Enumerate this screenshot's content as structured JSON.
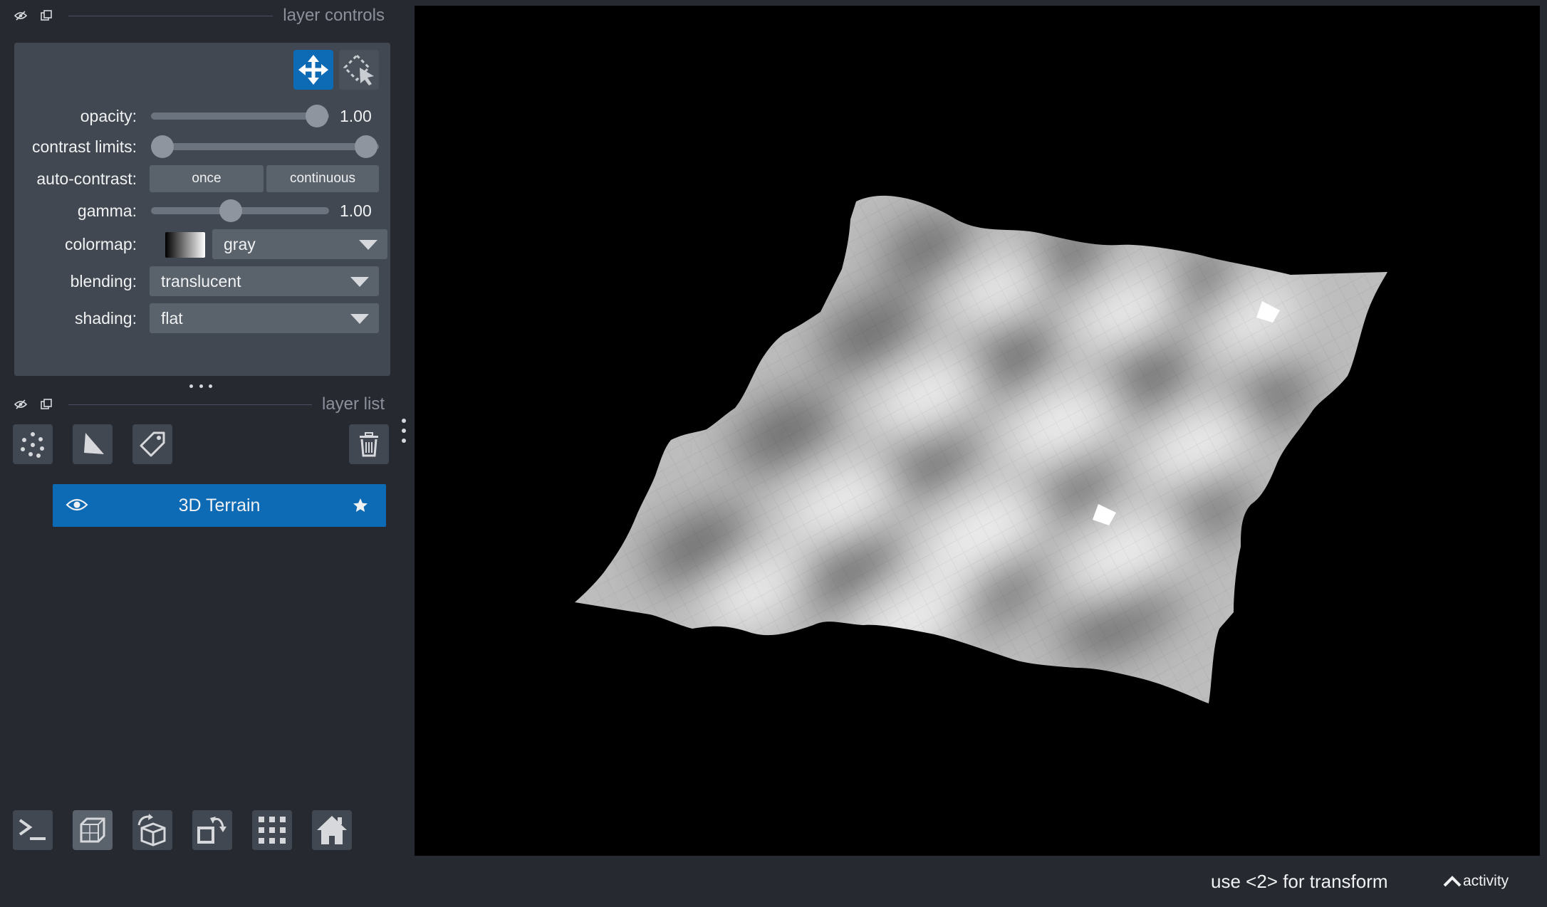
{
  "layer_controls": {
    "title": "layer controls",
    "opacity": {
      "label": "opacity:",
      "value": "1.00",
      "level": 1.0
    },
    "contrast_limits": {
      "label": "contrast limits:",
      "low": 0.0,
      "high": 1.0
    },
    "auto_contrast": {
      "label": "auto-contrast:",
      "once": "once",
      "continuous": "continuous"
    },
    "gamma": {
      "label": "gamma:",
      "value": "1.00",
      "level": 0.45
    },
    "colormap": {
      "label": "colormap:",
      "value": "gray"
    },
    "blending": {
      "label": "blending:",
      "value": "translucent"
    },
    "shading": {
      "label": "shading:",
      "value": "flat"
    }
  },
  "layer_list": {
    "title": "layer list",
    "layers": [
      {
        "name": "3D Terrain",
        "visible": true,
        "selected": true
      }
    ]
  },
  "status": {
    "message": "use <2> for transform",
    "activity": "activity"
  },
  "colors": {
    "background": "#262930",
    "panel": "#414851",
    "accent": "#0d6ab4",
    "canvas": "#000000"
  },
  "icons": {
    "dock_header": [
      "eye-slash-icon",
      "float-window-icon"
    ],
    "modes": [
      "move-icon",
      "transform-select-icon"
    ],
    "layer_buttons": [
      "new-points-icon",
      "new-shapes-icon",
      "new-labels-icon",
      "delete-icon"
    ],
    "bottom_buttons": [
      "console-icon",
      "3d-view-icon",
      "roll-axes-icon",
      "transpose-icon",
      "grid-icon",
      "home-icon"
    ]
  }
}
